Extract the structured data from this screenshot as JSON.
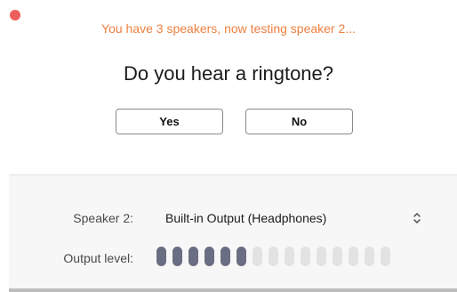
{
  "window": {
    "close_button_color": "#ee5f5b"
  },
  "header": {
    "status_text": "You have 3 speakers, now testing speaker 2...",
    "status_color": "#ef7f3f",
    "question": "Do you hear a ringtone?"
  },
  "buttons": {
    "yes_label": "Yes",
    "no_label": "No"
  },
  "settings": {
    "speaker_label": "Speaker 2:",
    "speaker_value": "Built-in Output (Headphones)",
    "output_label": "Output level:",
    "output_level": {
      "active_segments": 6,
      "total_segments": 15,
      "active_color": "#6b6e82",
      "inactive_color": "#e2e2e2"
    }
  }
}
